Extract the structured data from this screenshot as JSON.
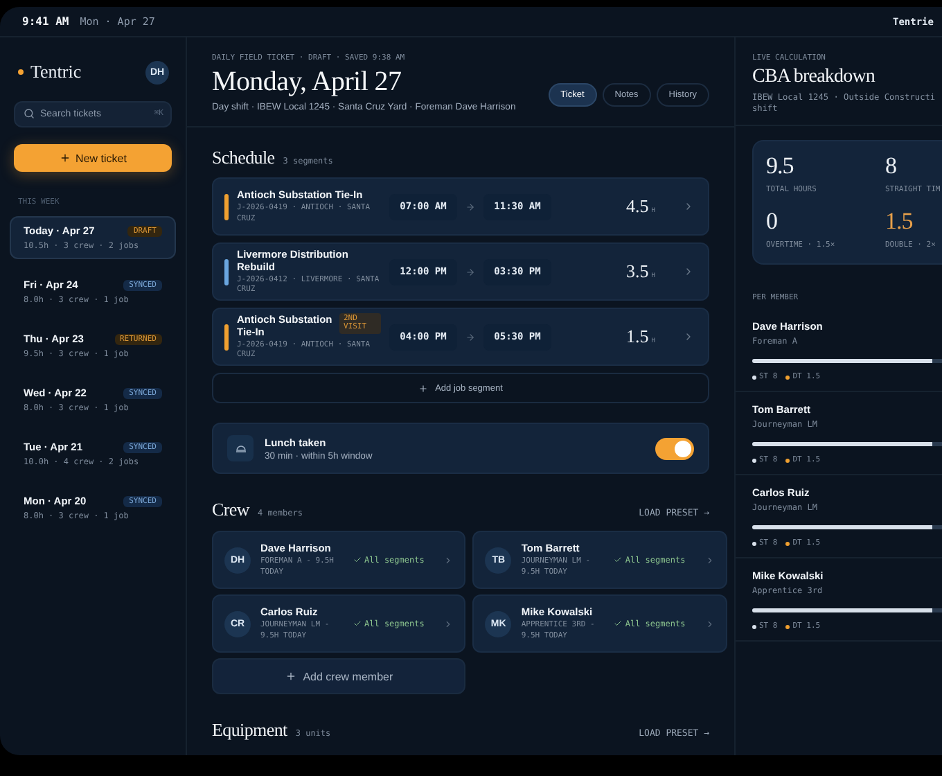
{
  "status_bar": {
    "time": "9:41 AM",
    "date": "Mon · Apr 27",
    "app": "Tentrie"
  },
  "sidebar": {
    "logo": "Tentric",
    "avatar": "DH",
    "search": {
      "placeholder": "Search tickets",
      "shortcut": "⌘K"
    },
    "new_ticket": "New ticket",
    "section": "THIS WEEK",
    "tickets": [
      {
        "day": "Today · Apr 27",
        "summary": "10.5h · 3 crew · 2 jobs",
        "status": "DRAFT",
        "kind": "draft",
        "selected": true
      },
      {
        "day": "Fri · Apr 24",
        "summary": "8.0h · 3 crew · 1 job",
        "status": "SYNCED",
        "kind": "synced",
        "selected": false
      },
      {
        "day": "Thu · Apr 23",
        "summary": "9.5h · 3 crew · 1 job",
        "status": "RETURNED",
        "kind": "returned",
        "selected": false
      },
      {
        "day": "Wed · Apr 22",
        "summary": "8.0h · 3 crew · 1 job",
        "status": "SYNCED",
        "kind": "synced",
        "selected": false
      },
      {
        "day": "Tue · Apr 21",
        "summary": "10.0h · 4 crew · 2 jobs",
        "status": "SYNCED",
        "kind": "synced",
        "selected": false
      },
      {
        "day": "Mon · Apr 20",
        "summary": "8.0h · 3 crew · 1 job",
        "status": "SYNCED",
        "kind": "synced",
        "selected": false
      }
    ]
  },
  "header": {
    "overline": "DAILY FIELD TICKET · DRAFT · SAVED 9:38 AM",
    "title": "Monday, April 27",
    "subtitle": "Day shift · IBEW Local 1245 · Santa Cruz Yard · Foreman Dave Harrison",
    "tabs": [
      {
        "label": "Ticket",
        "selected": true
      },
      {
        "label": "Notes",
        "selected": false
      },
      {
        "label": "History",
        "selected": false
      }
    ]
  },
  "schedule": {
    "title": "Schedule",
    "count": "3 segments",
    "segments": [
      {
        "title": "Antioch Substation Tie-In",
        "meta": "J-2026-0419 · ANTIOCH · SANTA CRUZ",
        "start": "07:00 AM",
        "end": "11:30 AM",
        "hours": "4.5",
        "unit": "H",
        "color": "#f0a030"
      },
      {
        "title": "Livermore Distribution Rebuild",
        "meta": "J-2026-0412 · LIVERMORE · SANTA CRUZ",
        "start": "12:00 PM",
        "end": "03:30 PM",
        "hours": "3.5",
        "unit": "H",
        "color": "#6aa6e0"
      },
      {
        "title": "Antioch Substation Tie-In",
        "badge": "2ND VISIT",
        "meta": "J-2026-0419 · ANTIOCH · SANTA CRUZ",
        "start": "04:00 PM",
        "end": "05:30 PM",
        "hours": "1.5",
        "unit": "H",
        "color": "#f0a030"
      }
    ],
    "add": "Add job segment"
  },
  "lunch": {
    "title": "Lunch taken",
    "detail": "30 min · within 5h window",
    "on": true
  },
  "crew": {
    "title": "Crew",
    "count": "4 members",
    "action": "LOAD PRESET →",
    "members": [
      {
        "initials": "DH",
        "name": "Dave Harrison",
        "role": "FOREMAN A - 9.5H TODAY",
        "status": "All segments"
      },
      {
        "initials": "TB",
        "name": "Tom Barrett",
        "role": "JOURNEYMAN LM - 9.5H TODAY",
        "status": "All segments"
      },
      {
        "initials": "CR",
        "name": "Carlos Ruiz",
        "role": "JOURNEYMAN LM - 9.5H TODAY",
        "status": "All segments"
      },
      {
        "initials": "MK",
        "name": "Mike Kowalski",
        "role": "APPRENTICE 3RD - 9.5H TODAY",
        "status": "All segments"
      }
    ],
    "add": "Add crew member"
  },
  "equipment": {
    "title": "Equipment",
    "count": "3 units",
    "action": "LOAD PRESET →"
  },
  "calculation": {
    "overline": "LIVE CALCULATION",
    "title": "CBA breakdown",
    "subtitle_lines": [
      "IBEW Local 1245 · Outside Constructi",
      "shift"
    ],
    "stats": [
      {
        "value": "9.5",
        "label": "TOTAL HOURS",
        "accent": false
      },
      {
        "value": "8",
        "label": "STRAIGHT TIM",
        "accent": false
      },
      {
        "value": "0",
        "label": "OVERTIME · 1.5×",
        "accent": false
      },
      {
        "value": "1.5",
        "label": "DOUBLE · 2×",
        "accent": true
      }
    ],
    "section": "PER MEMBER",
    "members": [
      {
        "name": "Dave Harrison",
        "role": "Foreman A",
        "level": 0.95,
        "legend": [
          {
            "label": "ST 8",
            "color": "#d8e0ea"
          },
          {
            "label": "DT 1.5",
            "color": "#f0a030"
          }
        ]
      },
      {
        "name": "Tom Barrett",
        "role": "Journeyman LM",
        "level": 0.95,
        "legend": [
          {
            "label": "ST 8",
            "color": "#d8e0ea"
          },
          {
            "label": "DT 1.5",
            "color": "#f0a030"
          }
        ]
      },
      {
        "name": "Carlos Ruiz",
        "role": "Journeyman LM",
        "level": 0.95,
        "legend": [
          {
            "label": "ST 8",
            "color": "#d8e0ea"
          },
          {
            "label": "DT 1.5",
            "color": "#f0a030"
          }
        ]
      },
      {
        "name": "Mike Kowalski",
        "role": "Apprentice 3rd",
        "level": 0.95,
        "legend": [
          {
            "label": "ST 8",
            "color": "#d8e0ea"
          },
          {
            "label": "DT 1.5",
            "color": "#f0a030"
          }
        ]
      }
    ]
  }
}
